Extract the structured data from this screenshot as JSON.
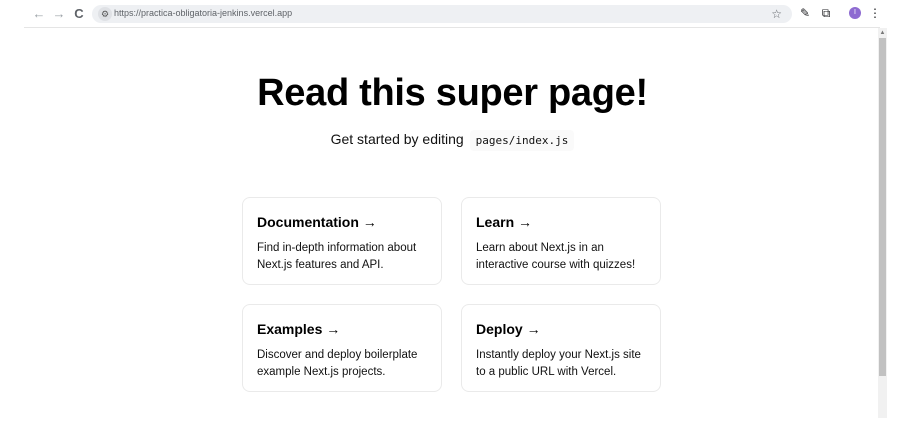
{
  "browser": {
    "url": "https://practica-obligatoria-jenkins.vercel.app",
    "back_icon": "←",
    "forward_icon": "→",
    "reload_icon": "C",
    "tune_icon": "⚙",
    "star_icon": "☆",
    "pen_icon": "✎",
    "extensions_icon": "⧉",
    "avatar_letter": "I",
    "menu_icon": "⋮"
  },
  "page": {
    "title": "Read this super page!",
    "subtitle": "Get started by editing",
    "code": "pages/index.js",
    "cards": [
      {
        "title": "Documentation →",
        "description": "Find in-depth information about Next.js features and API."
      },
      {
        "title": "Learn →",
        "description": "Learn about Next.js in an interactive course with quizzes!"
      },
      {
        "title": "Examples →",
        "description": "Discover and deploy boilerplate example Next.js projects."
      },
      {
        "title": "Deploy →",
        "description": "Instantly deploy your Next.js site to a public URL with Vercel."
      }
    ]
  }
}
